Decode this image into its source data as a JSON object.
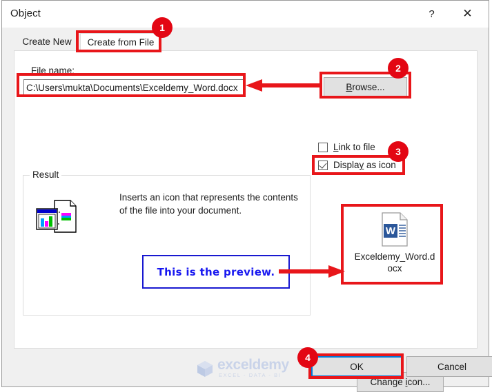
{
  "window": {
    "title": "Object",
    "help_button": "?",
    "close_button": "✕"
  },
  "tabs": [
    {
      "id": "create-new",
      "label": "Create New",
      "active": false
    },
    {
      "id": "create-from-file",
      "label": "Create from File",
      "active": true
    }
  ],
  "form": {
    "file_name_label_pre": "File ",
    "file_name_label_key": "n",
    "file_name_label_post": "ame:",
    "file_name_value": "C:\\Users\\mukta\\Documents\\Exceldemy_Word.docx",
    "file_name_placeholder": "",
    "browse_button_key": "B",
    "browse_button_rest": "rowse...",
    "link_to_file": {
      "label_key": "L",
      "label_rest": "ink to file",
      "checked": false
    },
    "display_as_icon": {
      "label_pre": "Displa",
      "label_key": "y",
      "label_post": " as icon",
      "checked": true
    }
  },
  "result": {
    "legend": "Result",
    "description": "Inserts an icon that represents the contents of the file into your document.",
    "icon_name": "document-chart-icon"
  },
  "preview": {
    "callout_text": "This is the preview.",
    "word_icon_name": "word-document-icon",
    "word_file_name": "Exceldemy_Word.docx"
  },
  "buttons": {
    "change_icon_pre": "Change ",
    "change_icon_key": "i",
    "change_icon_post": "con...",
    "ok": "OK",
    "cancel": "Cancel"
  },
  "watermark": {
    "name": "exceldemy",
    "tagline": "EXCEL - DATA - BI"
  },
  "annotations": {
    "badges": [
      "1",
      "2",
      "3",
      "4"
    ],
    "highlight_color": "#e8161a",
    "callout_color": "#1818f0",
    "focus_color": "#0078d7"
  }
}
